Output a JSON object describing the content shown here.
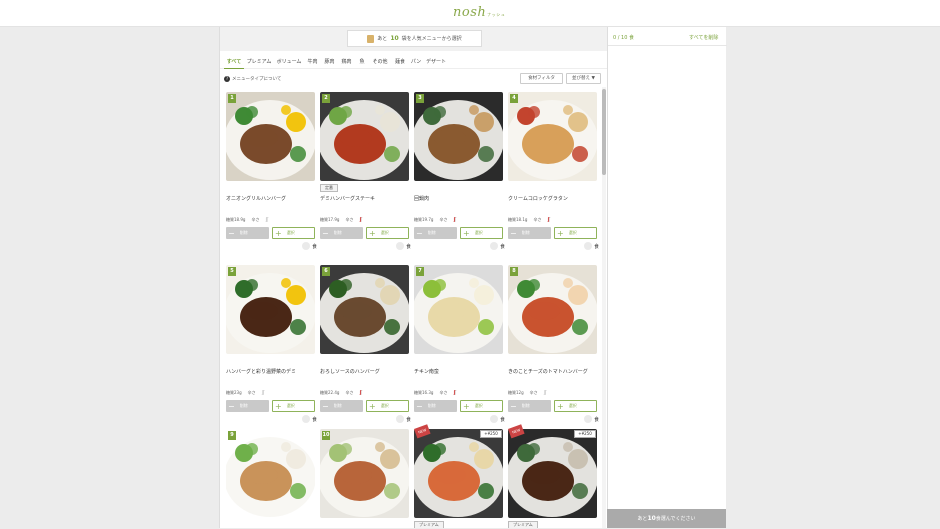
{
  "header": {
    "logo": "nosh",
    "logo_sub": "ナッシュ"
  },
  "banner": {
    "pre": "あと",
    "count": "10",
    "post": "袋を人気メニューから選択"
  },
  "tabs": [
    "すべて",
    "プレミアム",
    "ボリューム",
    "牛肉",
    "豚肉",
    "鶏肉",
    "魚",
    "その他",
    "麺食",
    "パン",
    "デザート"
  ],
  "toolbar": {
    "type_info": "メニュータイプについて",
    "filter": "食材フィルタ",
    "sort": "並び替え ▼"
  },
  "cards": [
    {
      "num": "1",
      "name": "オニオングリルハンバーグ",
      "carb": "糖質18.9g",
      "spicy_label": "辛さ",
      "spicy": 0,
      "tag": "",
      "price": "",
      "new": false,
      "del": "削除",
      "sel": "選択",
      "qty_unit": "食",
      "img": "img1"
    },
    {
      "num": "2",
      "name": "デミハンバーグステーキ",
      "carb": "糖質17.9g",
      "spicy_label": "辛さ",
      "spicy": 2,
      "tag": "定番",
      "price": "",
      "new": false,
      "del": "削除",
      "sel": "選択",
      "qty_unit": "食",
      "img": "img2"
    },
    {
      "num": "3",
      "name": "回鍋肉",
      "carb": "糖質19.7g",
      "spicy_label": "辛さ",
      "spicy": 2,
      "tag": "",
      "price": "",
      "new": false,
      "del": "削除",
      "sel": "選択",
      "qty_unit": "食",
      "img": "img3"
    },
    {
      "num": "4",
      "name": "クリームコロッケグラタン",
      "carb": "糖質18.1g",
      "spicy_label": "辛さ",
      "spicy": 2,
      "tag": "",
      "price": "",
      "new": false,
      "del": "削除",
      "sel": "選択",
      "qty_unit": "食",
      "img": "img4"
    },
    {
      "num": "5",
      "name": "ハンバーグと彩り温野菜のデミ",
      "carb": "糖質23g",
      "spicy_label": "辛さ",
      "spicy": 0,
      "tag": "",
      "price": "",
      "new": false,
      "del": "削除",
      "sel": "選択",
      "qty_unit": "食",
      "img": "img5"
    },
    {
      "num": "6",
      "name": "おろしソースのハンバーグ",
      "carb": "糖質22.4g",
      "spicy_label": "辛さ",
      "spicy": 2,
      "tag": "",
      "price": "",
      "new": false,
      "del": "削除",
      "sel": "選択",
      "qty_unit": "食",
      "img": "img6"
    },
    {
      "num": "7",
      "name": "チキン南蛮",
      "carb": "糖質16.3g",
      "spicy_label": "辛さ",
      "spicy": 2,
      "tag": "",
      "price": "",
      "new": false,
      "del": "削除",
      "sel": "選択",
      "qty_unit": "食",
      "img": "img7"
    },
    {
      "num": "8",
      "name": "きのことチーズのトマトハンバーグ",
      "carb": "糖質12g",
      "spicy_label": "辛さ",
      "spicy": 0,
      "tag": "",
      "price": "",
      "new": false,
      "del": "削除",
      "sel": "選択",
      "qty_unit": "食",
      "img": "img8"
    },
    {
      "num": "9",
      "name": "",
      "carb": "",
      "spicy_label": "",
      "spicy": 0,
      "tag": "",
      "price": "",
      "new": false,
      "del": "",
      "sel": "",
      "qty_unit": "",
      "img": "img9"
    },
    {
      "num": "10",
      "name": "",
      "carb": "",
      "spicy_label": "",
      "spicy": 0,
      "tag": "",
      "price": "",
      "new": false,
      "del": "",
      "sel": "",
      "qty_unit": "",
      "img": "img10"
    },
    {
      "num": "",
      "name": "",
      "carb": "",
      "spicy_label": "",
      "spicy": 0,
      "tag": "プレミアム",
      "price": "+¥250",
      "new": true,
      "new_label": "NEW",
      "del": "",
      "sel": "",
      "qty_unit": "",
      "img": "img11"
    },
    {
      "num": "",
      "name": "",
      "carb": "",
      "spicy_label": "",
      "spicy": 0,
      "tag": "プレミアム",
      "price": "+¥250",
      "new": true,
      "new_label": "NEW",
      "del": "",
      "sel": "",
      "qty_unit": "",
      "img": "img12"
    }
  ],
  "cart": {
    "count": "0 / 10 食",
    "clear": "すべてを削除"
  },
  "footer_button": {
    "pre": "あと",
    "count": "10",
    "post": "食選んでください"
  },
  "colors": {
    "accent": "#7aa23a",
    "chili": "#cc3333",
    "disabled": "#c9c9c9",
    "footer": "#aaaaaa"
  }
}
